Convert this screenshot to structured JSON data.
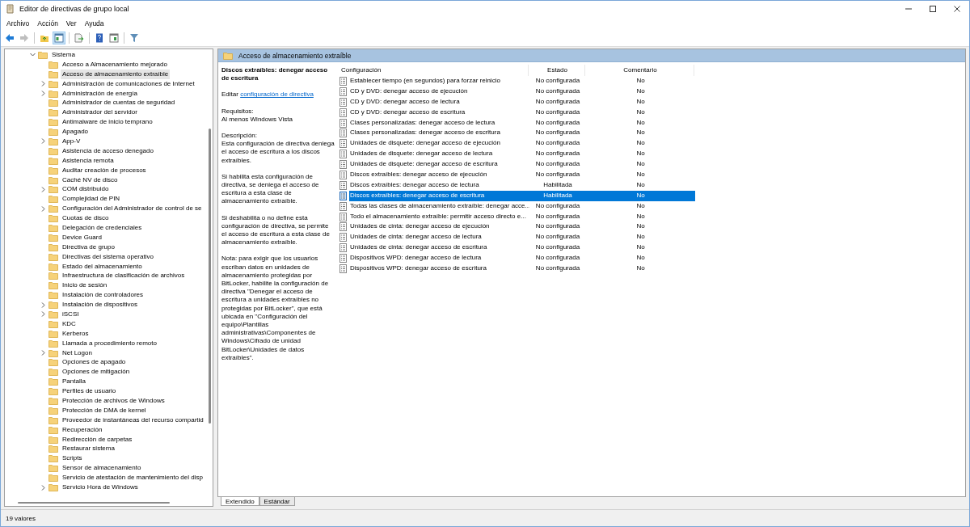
{
  "window": {
    "title": "Editor de directivas de grupo local"
  },
  "menu": [
    "Archivo",
    "Acción",
    "Ver",
    "Ayuda"
  ],
  "toolbar": [
    {
      "kind": "back",
      "disabled": false,
      "pressed": false
    },
    {
      "kind": "forward",
      "disabled": true,
      "pressed": false
    },
    {
      "kind": "separator"
    },
    {
      "kind": "up",
      "disabled": false,
      "pressed": false
    },
    {
      "kind": "tree",
      "disabled": false,
      "pressed": true
    },
    {
      "kind": "separator"
    },
    {
      "kind": "export",
      "disabled": false,
      "pressed": false
    },
    {
      "kind": "separator"
    },
    {
      "kind": "help",
      "disabled": false,
      "pressed": false
    },
    {
      "kind": "view",
      "disabled": false,
      "pressed": false
    },
    {
      "kind": "separator"
    },
    {
      "kind": "filter",
      "disabled": false,
      "pressed": false
    }
  ],
  "tree": [
    {
      "label": "Sistema",
      "expanded": true,
      "selected": false,
      "children": [
        {
          "label": "Acceso a Almacenamiento mejorado",
          "selected": false
        },
        {
          "label": "Acceso de almacenamiento extraíble",
          "selected": true
        },
        {
          "label": "Administración de comunicaciones de Internet",
          "selected": false,
          "expanded": false
        },
        {
          "label": "Administración de energía",
          "selected": false,
          "expanded": false
        },
        {
          "label": "Administrador de cuentas de seguridad",
          "selected": false
        },
        {
          "label": "Administrador del servidor",
          "selected": false
        },
        {
          "label": "Antimalware de inicio temprano",
          "selected": false
        },
        {
          "label": "Apagado",
          "selected": false
        },
        {
          "label": "App-V",
          "selected": false,
          "expanded": false
        },
        {
          "label": "Asistencia de acceso denegado",
          "selected": false
        },
        {
          "label": "Asistencia remota",
          "selected": false
        },
        {
          "label": "Auditar creación de procesos",
          "selected": false
        },
        {
          "label": "Caché NV de disco",
          "selected": false
        },
        {
          "label": "COM distribuido",
          "selected": false,
          "expanded": false
        },
        {
          "label": "Complejidad de PIN",
          "selected": false
        },
        {
          "label": "Configuración del Administrador de control de se",
          "selected": false,
          "expanded": false
        },
        {
          "label": "Cuotas de disco",
          "selected": false
        },
        {
          "label": "Delegación de credenciales",
          "selected": false
        },
        {
          "label": "Device Guard",
          "selected": false
        },
        {
          "label": "Directiva de grupo",
          "selected": false
        },
        {
          "label": "Directivas del sistema operativo",
          "selected": false
        },
        {
          "label": "Estado del almacenamiento",
          "selected": false
        },
        {
          "label": "Infraestructura de clasificación de archivos",
          "selected": false
        },
        {
          "label": "Inicio de sesión",
          "selected": false
        },
        {
          "label": "Instalación de controladores",
          "selected": false
        },
        {
          "label": "Instalación de dispositivos",
          "selected": false,
          "expanded": false
        },
        {
          "label": "iSCSI",
          "selected": false,
          "expanded": false
        },
        {
          "label": "KDC",
          "selected": false
        },
        {
          "label": "Kerberos",
          "selected": false
        },
        {
          "label": "Llamada a procedimiento remoto",
          "selected": false
        },
        {
          "label": "Net Logon",
          "selected": false,
          "expanded": false
        },
        {
          "label": "Opciones de apagado",
          "selected": false
        },
        {
          "label": "Opciones de mitigación",
          "selected": false
        },
        {
          "label": "Pantalla",
          "selected": false
        },
        {
          "label": "Perfiles de usuario",
          "selected": false
        },
        {
          "label": "Protección de archivos de Windows",
          "selected": false
        },
        {
          "label": "Protección de DMA de kernel",
          "selected": false
        },
        {
          "label": "Proveedor de instantáneas del recurso compartid",
          "selected": false
        },
        {
          "label": "Recuperación",
          "selected": false
        },
        {
          "label": "Redirección de carpetas",
          "selected": false
        },
        {
          "label": "Restaurar sistema",
          "selected": false
        },
        {
          "label": "Scripts",
          "selected": false
        },
        {
          "label": "Sensor de almacenamiento",
          "selected": false
        },
        {
          "label": "Servicio de atestación de mantenimiento del disp",
          "selected": false
        },
        {
          "label": "Servicio Hora de Windows",
          "selected": false,
          "expanded": false
        }
      ]
    }
  ],
  "details": {
    "header": "Acceso de almacenamiento extraíble",
    "policy_title": "Discos extraíbles: denegar acceso de escritura",
    "edit_prefix": "Editar",
    "edit_link": "configuración de directiva",
    "requirements_label": "Requisitos:",
    "requirements": "Al menos Windows Vista",
    "description_label": "Descripción:",
    "paragraphs": [
      "Esta configuración de directiva deniega el acceso de escritura a los discos extraíbles.",
      "Si habilita esta configuración de directiva, se deniega el acceso de escritura a esta clase de almacenamiento extraíble.",
      "Si deshabilita o no define esta configuración de directiva, se permite el acceso de escritura a esta clase de almacenamiento extraíble.",
      "Nota: para exigir que los usuarios escriban datos en unidades de almacenamiento protegidas por BitLocker, habilite la configuración de directiva \"Denegar el acceso de escritura a unidades extraíbles no protegidas por BitLocker\", que está ubicada en \"Configuración del equipo\\Plantillas administrativas\\Componentes de Windows\\Cifrado de unidad BitLocker\\Unidades de datos extraíbles\"."
    ]
  },
  "table": {
    "columns": [
      "Configuración",
      "Estado",
      "Comentario"
    ],
    "rows": [
      {
        "setting": "Establecer tiempo (en segundos) para forzar reinicio",
        "state": "No configurada",
        "comment": "No",
        "selected": false
      },
      {
        "setting": "CD y DVD: denegar acceso de ejecución",
        "state": "No configurada",
        "comment": "No",
        "selected": false
      },
      {
        "setting": "CD y DVD: denegar acceso de lectura",
        "state": "No configurada",
        "comment": "No",
        "selected": false
      },
      {
        "setting": "CD y DVD: denegar acceso de escritura",
        "state": "No configurada",
        "comment": "No",
        "selected": false
      },
      {
        "setting": "Clases personalizadas: denegar acceso de lectura",
        "state": "No configurada",
        "comment": "No",
        "selected": false
      },
      {
        "setting": "Clases personalizadas: denegar acceso de escritura",
        "state": "No configurada",
        "comment": "No",
        "selected": false
      },
      {
        "setting": "Unidades de disquete: denegar acceso de ejecución",
        "state": "No configurada",
        "comment": "No",
        "selected": false
      },
      {
        "setting": "Unidades de disquete: denegar acceso de lectura",
        "state": "No configurada",
        "comment": "No",
        "selected": false
      },
      {
        "setting": "Unidades de disquete: denegar acceso de escritura",
        "state": "No configurada",
        "comment": "No",
        "selected": false
      },
      {
        "setting": "Discos extraíbles: denegar acceso de ejecución",
        "state": "No configurada",
        "comment": "No",
        "selected": false
      },
      {
        "setting": "Discos extraíbles: denegar acceso de lectura",
        "state": "Habilitada",
        "comment": "No",
        "selected": false
      },
      {
        "setting": "Discos extraíbles: denegar acceso de escritura",
        "state": "Habilitada",
        "comment": "No",
        "selected": true
      },
      {
        "setting": "Todas las clases de almacenamiento extraíble: denegar acce...",
        "state": "No configurada",
        "comment": "No",
        "selected": false
      },
      {
        "setting": "Todo el almacenamiento extraíble: permitir acceso directo e...",
        "state": "No configurada",
        "comment": "No",
        "selected": false
      },
      {
        "setting": "Unidades de cinta: denegar acceso de ejecución",
        "state": "No configurada",
        "comment": "No",
        "selected": false
      },
      {
        "setting": "Unidades de cinta: denegar acceso de lectura",
        "state": "No configurada",
        "comment": "No",
        "selected": false
      },
      {
        "setting": "Unidades de cinta: denegar acceso de escritura",
        "state": "No configurada",
        "comment": "No",
        "selected": false
      },
      {
        "setting": "Dispositivos WPD: denegar acceso de lectura",
        "state": "No configurada",
        "comment": "No",
        "selected": false
      },
      {
        "setting": "Dispositivos WPD: denegar acceso de escritura",
        "state": "No configurada",
        "comment": "No",
        "selected": false
      }
    ]
  },
  "tabs": [
    {
      "label": "Extendido",
      "selected": true
    },
    {
      "label": "Estándar",
      "selected": false
    }
  ],
  "status_bar": "19 valores"
}
